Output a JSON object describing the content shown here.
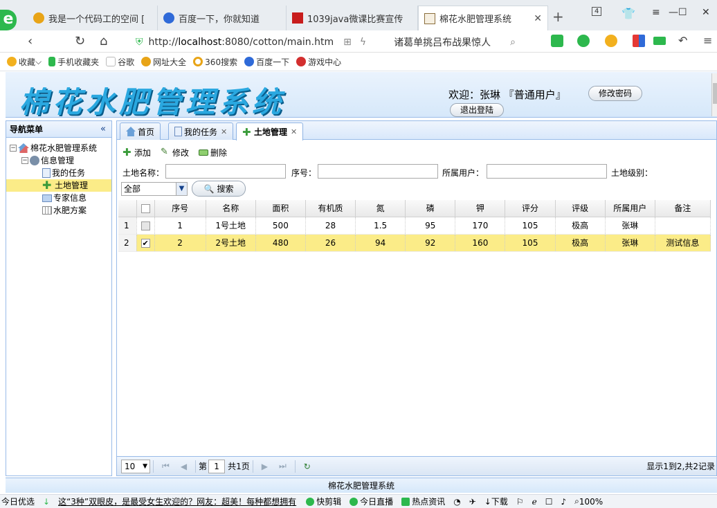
{
  "browser": {
    "tabs": [
      {
        "title": "我是一个代码工的空间 [",
        "color": "#e8a417"
      },
      {
        "title": "百度一下，你就知道",
        "color": "#2f6ad8"
      },
      {
        "title": "1039java微课比赛宣传",
        "color": "#c81d1d"
      },
      {
        "title": "棉花水肥管理系统",
        "color": "#8a6d3b"
      }
    ],
    "tab_count": "4",
    "url_prefix": "http://",
    "url_host": "localhost",
    "url_rest": ":8080/cotton/main.htm",
    "search_hint": "诸葛单挑吕布战果惊人",
    "bookmarks": [
      {
        "label": "收藏",
        "color": "#f2b01e"
      },
      {
        "label": "手机收藏夹",
        "color": "#2db84d"
      },
      {
        "label": "谷歌",
        "color": "#cccccc"
      },
      {
        "label": "网址大全",
        "color": "#e8a417"
      },
      {
        "label": "360搜索",
        "color": "#2db84d"
      },
      {
        "label": "百度一下",
        "color": "#2f6ad8"
      },
      {
        "label": "游戏中心",
        "color": "#d32f2f"
      }
    ]
  },
  "header": {
    "logo_text": "棉花水肥管理系统",
    "welcome": "欢迎：张琳 『普通用户』",
    "change_password": "修改密码",
    "logout": "退出登陆"
  },
  "sidebar": {
    "title": "导航菜单",
    "collapse_glyph": "«",
    "root": "棉花水肥管理系统",
    "group": "信息管理",
    "items": [
      "我的任务",
      "土地管理",
      "专家信息",
      "水肥方案"
    ]
  },
  "main": {
    "tabs": [
      "首页",
      "我的任务",
      "土地管理"
    ],
    "toolbar": {
      "add": "添加",
      "edit": "修改",
      "delete": "删除"
    },
    "filters": {
      "land_name": "土地名称：",
      "serial": "序号：",
      "owner": "所属用户：",
      "level": "土地级别：",
      "level_value": "全部",
      "search": "搜索"
    },
    "columns": [
      "序号",
      "名称",
      "面积",
      "有机质",
      "氮",
      "磷",
      "钾",
      "评分",
      "评级",
      "所属用户",
      "备注"
    ],
    "rows": [
      {
        "rn": "1",
        "checked": false,
        "cells": [
          "1",
          "1号土地",
          "500",
          "28",
          "1.5",
          "95",
          "170",
          "105",
          "极高",
          "张琳",
          ""
        ]
      },
      {
        "rn": "2",
        "checked": true,
        "cells": [
          "2",
          "2号土地",
          "480",
          "26",
          "94",
          "92",
          "160",
          "105",
          "极高",
          "张琳",
          "测试信息"
        ]
      }
    ],
    "pager": {
      "page_size": "10",
      "page_prefix": "第",
      "page": "1",
      "page_total": "共1页",
      "info": "显示1到2,共2记录"
    }
  },
  "footer": "棉花水肥管理系统",
  "statusbar": {
    "left": "今日优选",
    "news": "这“3种”双眼皮，是最受女生欢迎的？网友：超美！每种都想拥有",
    "items": [
      "快剪辑",
      "今日直播",
      "热点资讯"
    ],
    "download": "下载",
    "zoom": "100%"
  },
  "colors": {
    "accent": "#99bbe8",
    "selected": "#fbec88",
    "secure": "#2db84d"
  }
}
